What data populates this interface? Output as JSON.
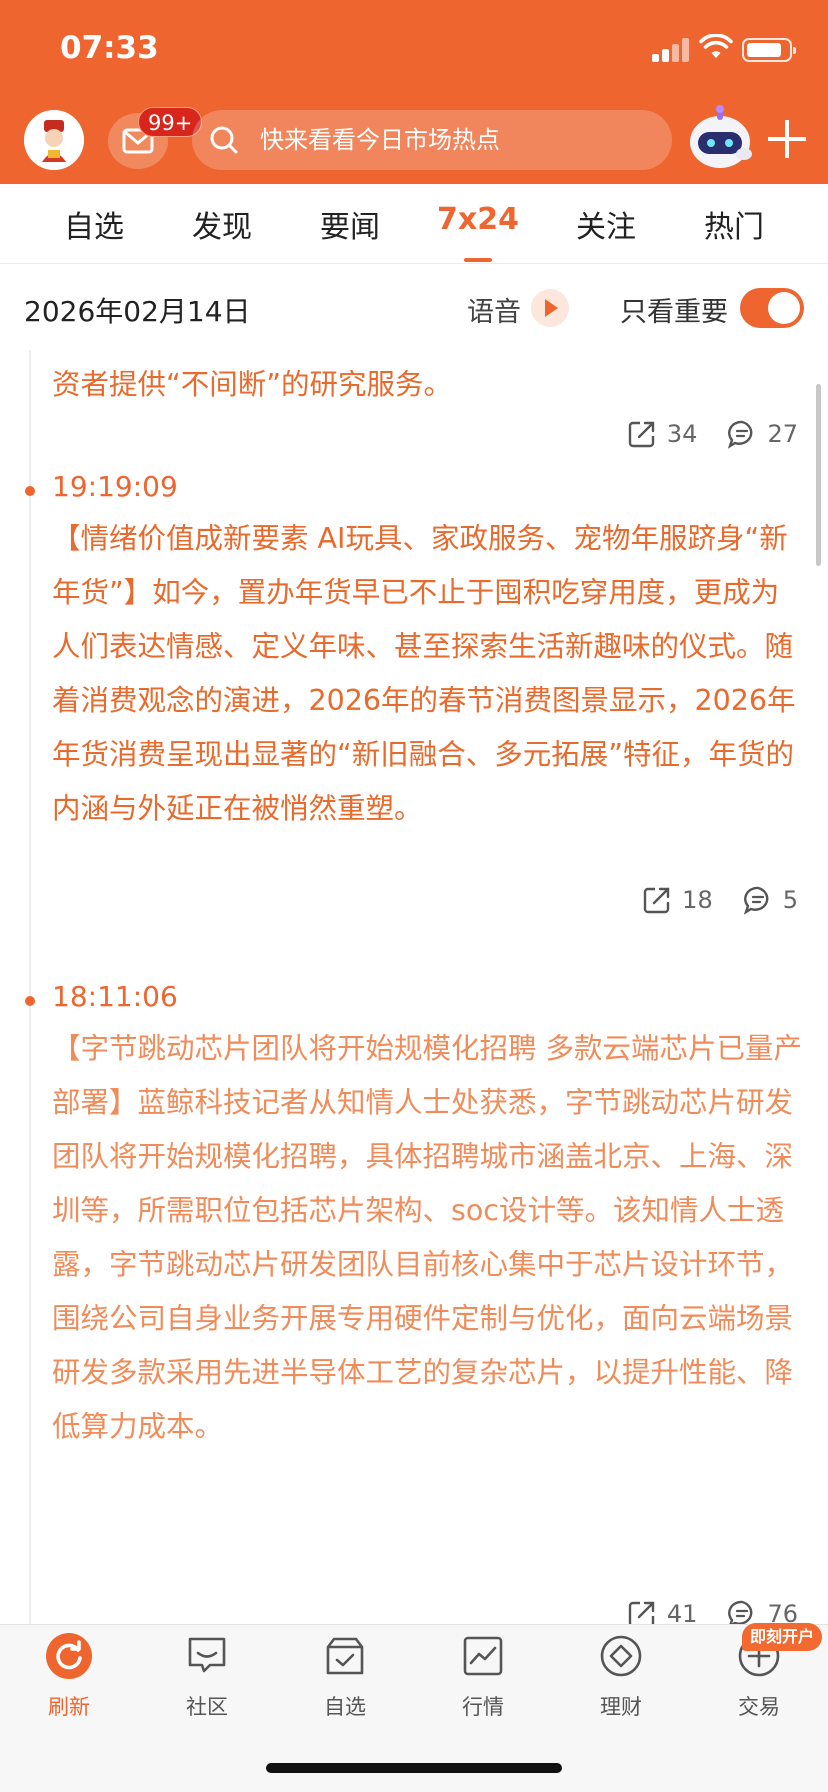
{
  "status_bar": {
    "time": "07:33"
  },
  "header": {
    "mail_badge": "99+",
    "search_placeholder": "快来看看今日市场热点"
  },
  "tabs": [
    {
      "label": "自选"
    },
    {
      "label": "发现"
    },
    {
      "label": "要闻"
    },
    {
      "label": "7x24",
      "active": true
    },
    {
      "label": "关注"
    },
    {
      "label": "热门"
    }
  ],
  "date_row": {
    "date": "2026年02月14日",
    "voice_label": "语音",
    "important_only_label": "只看重要",
    "important_only_on": true
  },
  "feed": {
    "items": [
      {
        "time": "",
        "text": "却在紧锣密鼓地开电话会、讲AI、聊港股，试图在假期为投资者提供“不间断”的研究服务。",
        "shares": "34",
        "comments": "27"
      },
      {
        "time": "19:19:09",
        "text": "【情绪价值成新要素 AI玩具、家政服务、宠物年服跻身“新年货”】如今，置办年货早已不止于囤积吃穿用度，更成为人们表达情感、定义年味、甚至探索生活新趣味的仪式。随着消费观念的演进，2026年的春节消费图景显示，2026年年货消费呈现出显著的“新旧融合、多元拓展”特征，年货的内涵与外延正在被悄然重塑。",
        "shares": "18",
        "comments": "5"
      },
      {
        "time": "18:11:06",
        "text": "【字节跳动芯片团队将开始规模化招聘 多款云端芯片已量产部署】蓝鲸科技记者从知情人士处获悉，字节跳动芯片研发团队将开始规模化招聘，具体招聘城市涵盖北京、上海、深圳等，所需职位包括芯片架构、soc设计等。该知情人士透露，字节跳动芯片研发团队目前核心集中于芯片设计环节，围绕公司自身业务开展专用硬件定制与优化，面向云端场景研发多款采用先进半导体工艺的复杂芯片，以提升性能、降低算力成本。",
        "shares": "41",
        "comments": "76"
      }
    ]
  },
  "bottom_nav": {
    "items": [
      {
        "label": "刷新",
        "icon": "refresh-icon",
        "active": true
      },
      {
        "label": "社区",
        "icon": "community-icon"
      },
      {
        "label": "自选",
        "icon": "watchlist-icon"
      },
      {
        "label": "行情",
        "icon": "market-icon"
      },
      {
        "label": "理财",
        "icon": "wealth-icon"
      },
      {
        "label": "交易",
        "icon": "trade-icon"
      }
    ],
    "open_account_badge": "即刻开户"
  },
  "colors": {
    "brand": "#ee6530",
    "news_text": "#e86a2c"
  }
}
